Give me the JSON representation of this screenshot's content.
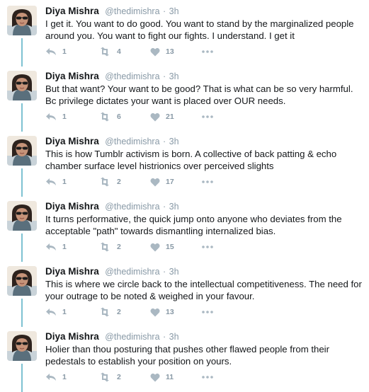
{
  "colors": {
    "name": "#14171a",
    "muted": "#8899a6",
    "thread_line": "#7ec2d2"
  },
  "tweets": [
    {
      "name": "Diya Mishra",
      "handle": "@thedimishra",
      "sep": "·",
      "time": "3h",
      "text": "I get it. You want to do good. You want to stand by the marginalized people around you. You want to fight our fights. I understand. I get it",
      "replies": "1",
      "retweets": "4",
      "likes": "13"
    },
    {
      "name": "Diya Mishra",
      "handle": "@thedimishra",
      "sep": "·",
      "time": "3h",
      "text": "But that want? Your want to be good? That is what can be so very harmful. Bc privilege dictates your want is placed over OUR needs.",
      "replies": "1",
      "retweets": "6",
      "likes": "21"
    },
    {
      "name": "Diya Mishra",
      "handle": "@thedimishra",
      "sep": "·",
      "time": "3h",
      "text": "This is how Tumblr activism is born. A collective of back patting & echo chamber surface level histrionics over perceived slights",
      "replies": "1",
      "retweets": "2",
      "likes": "17"
    },
    {
      "name": "Diya Mishra",
      "handle": "@thedimishra",
      "sep": "·",
      "time": "3h",
      "text": "It turns performative, the quick jump onto anyone who deviates from the acceptable \"path\" towards dismantling internalized bias.",
      "replies": "1",
      "retweets": "2",
      "likes": "15"
    },
    {
      "name": "Diya Mishra",
      "handle": "@thedimishra",
      "sep": "·",
      "time": "3h",
      "text": "This is where we circle back to the intellectual competitiveness. The need for your outrage to be noted & weighed in your favour.",
      "replies": "1",
      "retweets": "2",
      "likes": "13"
    },
    {
      "name": "Diya Mishra",
      "handle": "@thedimishra",
      "sep": "·",
      "time": "3h",
      "text": "Holier than thou posturing that pushes other flawed people from their pedestals to establish your position on yours.",
      "replies": "1",
      "retweets": "2",
      "likes": "11"
    }
  ]
}
